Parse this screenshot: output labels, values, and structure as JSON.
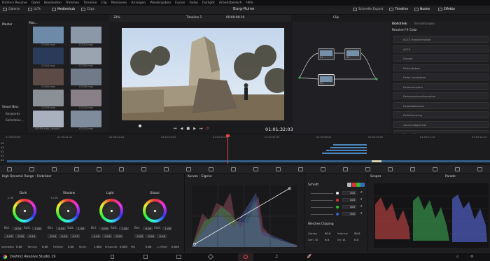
{
  "menubar": {
    "items": [
      "DaVinci Resolve",
      "Datei",
      "Bearbeiten",
      "Trimmen",
      "Timeline",
      "Clip",
      "Markieren",
      "Anzeigen",
      "Wiedergaben",
      "Fusion",
      "Farbe",
      "Fairlight",
      "Arbeitsbereich",
      "Hilfe"
    ]
  },
  "toolbar": {
    "left": [
      "Galerie",
      "LUTs",
      "Medienhub",
      "Clips"
    ],
    "project_title": "Burg-Ruine",
    "right": [
      "Schnelle Export",
      "Timeline",
      "Nodes",
      "Effekte"
    ],
    "clip_label": "Clip"
  },
  "viewer": {
    "zoom": "33%",
    "timeline_name": "Timeline 1",
    "timecode_top": "00:00:09:19",
    "timecode": "01:01:32:03"
  },
  "media_pool": {
    "master_label": "Master",
    "smart_bins_label": "Smart Bins",
    "smart_items": [
      "Keywords",
      "Sollsdelux..."
    ],
    "media_tab": "Mat...",
    "thumbs": [
      {
        "label": "C0200.mov",
        "color": "#6d8aa8"
      },
      {
        "label": "C0201.mov",
        "color": "#8a98a8"
      },
      {
        "label": "C0204.mov",
        "color": "#2a3a5a"
      },
      {
        "label": "C0200.mov",
        "color": "#9aa4b0"
      },
      {
        "label": "C0300.mov",
        "color": "#5b4a45"
      },
      {
        "label": "C0205.mov",
        "color": "#707a88"
      },
      {
        "label": "C0209.mov",
        "color": "#8b8f96"
      },
      {
        "label": "C0210.mov",
        "color": "#8a8088"
      },
      {
        "label": "C0209-auto_couplet...",
        "color": "#a9b1bf"
      },
      {
        "label": "C0212.mov",
        "color": "#7e8c9c"
      }
    ]
  },
  "nodes": {
    "node_labels": [
      "01",
      "02",
      "03"
    ]
  },
  "library": {
    "tabs": [
      "Bibliothek",
      "Einstellungen"
    ],
    "title": "Resolve FX Color",
    "items": [
      "ACES Transformation",
      "ACES",
      "Doppel",
      "Falschfarben",
      "Farbe invertieren",
      "Farbexempiare",
      "Farbraumtransformation",
      "Farbstabilisierer",
      "Farbstimmung",
      "Gamut-Begrenzer",
      "Gamut-Mapping"
    ]
  },
  "timeline": {
    "ruler": [
      "01:00:00:00",
      "01:00:21:11",
      "01:00:42:22",
      "01:01:04:05",
      "01:01:25:16",
      "01:01:47:03",
      "01:02:08:15",
      "01:02:30:02",
      "01:02:51:13",
      "01:03:12:24"
    ],
    "tracks": [
      "V4",
      "V3",
      "V2",
      "V1",
      "A1"
    ]
  },
  "hdr": {
    "title": "High Dynamic Range – Farbräder",
    "wheels": [
      {
        "name": "Dark",
        "exp": "-1.00",
        "dx": "0.00",
        "sat": "1.00",
        "y": "0.00",
        "z": "0.20"
      },
      {
        "name": "Shadow",
        "exp": "+1.00",
        "dx": "0.00",
        "sat": "1.00",
        "y": "0.00",
        "z": "0.22"
      },
      {
        "name": "Light",
        "exp": "",
        "dx": "0.00",
        "sat": "1.00",
        "y": "0.00",
        "z": "0.22"
      },
      {
        "name": "Global",
        "exp": "",
        "dx": "0.00",
        "sat": "1.00",
        "y": "0.00",
        "z": "0.00"
      }
    ],
    "row_labels": [
      "Bel.",
      "Satt.",
      "Bel.",
      "Satt.",
      "Bel.",
      "Satt.",
      "Bel.",
      "Satt."
    ],
    "bottom": [
      {
        "k": "spezialbo",
        "v": "0.00"
      },
      {
        "k": "Tönung",
        "v": "0.00"
      },
      {
        "k": "Farbton",
        "v": "0.00"
      },
      {
        "k": "Kontr.",
        "v": "1.000"
      },
      {
        "k": "ehspunkt",
        "v": "0.000"
      },
      {
        "k": "MD",
        "v": "0.00"
      },
      {
        "k": "L-Offset",
        "v": "0.000"
      }
    ]
  },
  "curves": {
    "title": "Kurven – Eigene"
  },
  "schnitt": {
    "title": "Schnitt",
    "values": [
      "100",
      "100",
      "100",
      "100"
    ],
    "soft_title": "Weiches Clipping",
    "soft": [
      {
        "k": "Gering",
        "v": "50.0"
      },
      {
        "k": "Intensiv",
        "v": "50.0"
      },
      {
        "k": "Gen. W.",
        "v": "0.0"
      },
      {
        "k": "Int. W.",
        "v": "0.0"
      }
    ]
  },
  "scopes": {
    "title": "Scopes",
    "mode": "Parade"
  },
  "pagebar": {
    "app": "DaVinci Resolve Studio 19"
  },
  "colors": {
    "accent": "#e84a3a",
    "node_green": "#2fb54a",
    "bg": "#1b1b1d"
  }
}
